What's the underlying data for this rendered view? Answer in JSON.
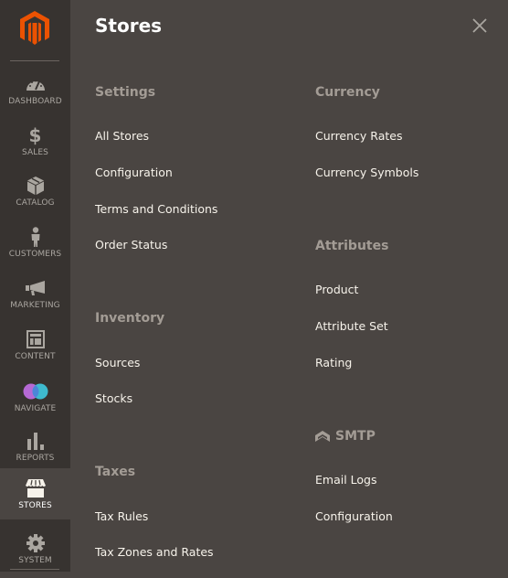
{
  "sidebar": {
    "items": [
      {
        "label": "DASHBOARD",
        "icon": "dashboard-icon"
      },
      {
        "label": "SALES",
        "icon": "dollar-icon"
      },
      {
        "label": "CATALOG",
        "icon": "box-icon"
      },
      {
        "label": "CUSTOMERS",
        "icon": "person-icon"
      },
      {
        "label": "MARKETING",
        "icon": "megaphone-icon"
      },
      {
        "label": "CONTENT",
        "icon": "layout-icon"
      },
      {
        "label": "NAVIGATE",
        "icon": "navigate-icon"
      },
      {
        "label": "REPORTS",
        "icon": "bar-chart-icon"
      },
      {
        "label": "STORES",
        "icon": "storefront-icon",
        "active": true
      },
      {
        "label": "SYSTEM",
        "icon": "gear-icon"
      }
    ],
    "sales_glyph": "$"
  },
  "panel": {
    "title": "Stores",
    "sections": {
      "settings": {
        "title": "Settings",
        "links": [
          "All Stores",
          "Configuration",
          "Terms and Conditions",
          "Order Status"
        ]
      },
      "inventory": {
        "title": "Inventory",
        "links": [
          "Sources",
          "Stocks"
        ]
      },
      "taxes": {
        "title": "Taxes",
        "links": [
          "Tax Rules",
          "Tax Zones and Rates"
        ]
      },
      "currency": {
        "title": "Currency",
        "links": [
          "Currency Rates",
          "Currency Symbols"
        ]
      },
      "attributes": {
        "title": "Attributes",
        "links": [
          "Product",
          "Attribute Set",
          "Rating"
        ]
      },
      "smtp": {
        "title": "SMTP",
        "links": [
          "Email Logs",
          "Configuration"
        ]
      }
    }
  },
  "colors": {
    "brand": "#eb5202",
    "sidebar_bg": "#373330",
    "panel_bg": "#4a4542"
  }
}
